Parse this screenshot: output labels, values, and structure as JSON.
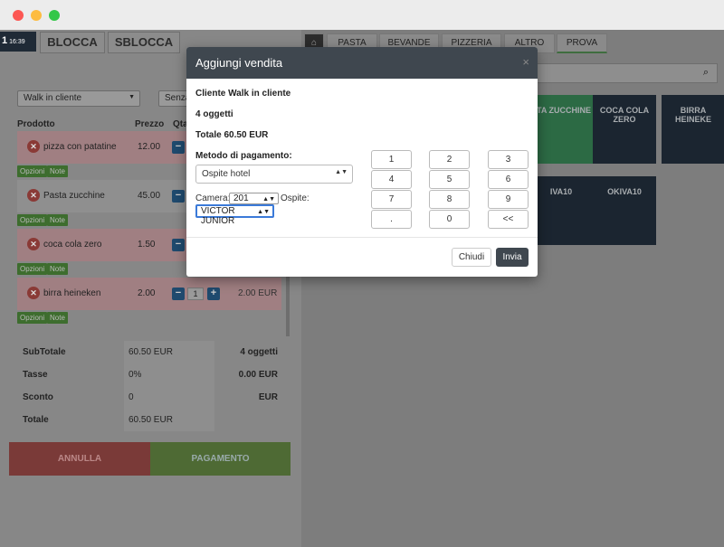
{
  "header": {
    "time_big": "1",
    "time_small": "16:39",
    "lock_label": "BLOCCA",
    "unlock_label": "SBLOCCA"
  },
  "filters": {
    "customer": "Walk in cliente",
    "second": "Senza"
  },
  "table": {
    "headers": [
      "Prodotto",
      "Prezzo",
      "Qta"
    ],
    "rows": [
      {
        "name": "pizza con patatine",
        "price": "12.00",
        "qty": "",
        "total": ""
      },
      {
        "name": "Pasta zucchine",
        "price": "45.00",
        "qty": "",
        "total": ""
      },
      {
        "name": "coca cola zero",
        "price": "1.50",
        "qty": "",
        "total": ""
      },
      {
        "name": "birra heineken",
        "price": "2.00",
        "qty": "1",
        "total": "2.00 EUR"
      }
    ],
    "options_label": "Opzioni",
    "note_label": "Note"
  },
  "summary": {
    "subtotal_label": "SubTotale",
    "subtotal_value": "60.50 EUR",
    "items_count": "4 oggetti",
    "tax_label": "Tasse",
    "tax_value": "0%",
    "tax_amount": "0.00 EUR",
    "discount_label": "Sconto",
    "discount_value": "0",
    "discount_unit": "EUR",
    "total_label": "Totale",
    "total_value": "60.50 EUR"
  },
  "actions": {
    "cancel": "ANNULLA",
    "pay": "PAGAMENTO"
  },
  "categories": [
    "PASTA",
    "BEVANDE",
    "PIZZERIA",
    "ALTRO",
    "PROVA"
  ],
  "tiles": [
    "STA ZUCCHINE",
    "COCA COLA ZERO",
    "BIRRA HEINEKE",
    "IVA10",
    "OKIVA10"
  ],
  "modal": {
    "title": "Aggiungi vendita",
    "close": "×",
    "customer_line": "Cliente Walk in cliente",
    "items_line": "4 oggetti",
    "total_line": "Totale 60.50 EUR",
    "payment_label": "Metodo di pagamento:",
    "payment_value": "Ospite hotel",
    "room_label": "Camera:",
    "room_value": "201",
    "guest_label": "Ospite:",
    "guest_value": "VICTOR JUNIOR",
    "keys": [
      "1",
      "2",
      "3",
      "4",
      "5",
      "6",
      "7",
      "8",
      "9",
      ".",
      "0",
      "<<"
    ],
    "close_button": "Chiudi",
    "send_button": "Invia"
  }
}
